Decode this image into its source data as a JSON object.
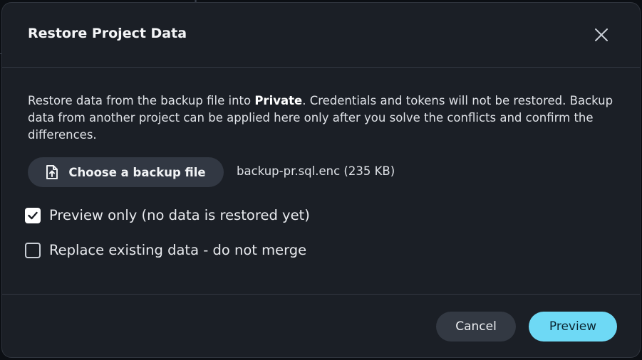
{
  "dialog": {
    "title": "Restore Project Data",
    "description": {
      "part1": "Restore data from the backup file into ",
      "project_name": "Private",
      "part2": ". Credentials and tokens will not be restored. Backup data from another project can be applied here only after you solve the conflicts and confirm the differences."
    },
    "file_button_label": "Choose a backup file",
    "file_name": "backup-pr.sql.enc (235 KB)",
    "options": [
      {
        "label": "Preview only (no data is restored yet)",
        "checked": true
      },
      {
        "label": "Replace existing data - do not merge",
        "checked": false
      }
    ],
    "cancel_label": "Cancel",
    "preview_label": "Preview"
  },
  "icons": {
    "close": "close-icon",
    "file_upload": "file-upload-icon",
    "check": "check-icon"
  },
  "colors": {
    "dialog_bg": "#1b1f26",
    "button_bg": "#323843",
    "accent": "#6ed9f5"
  }
}
